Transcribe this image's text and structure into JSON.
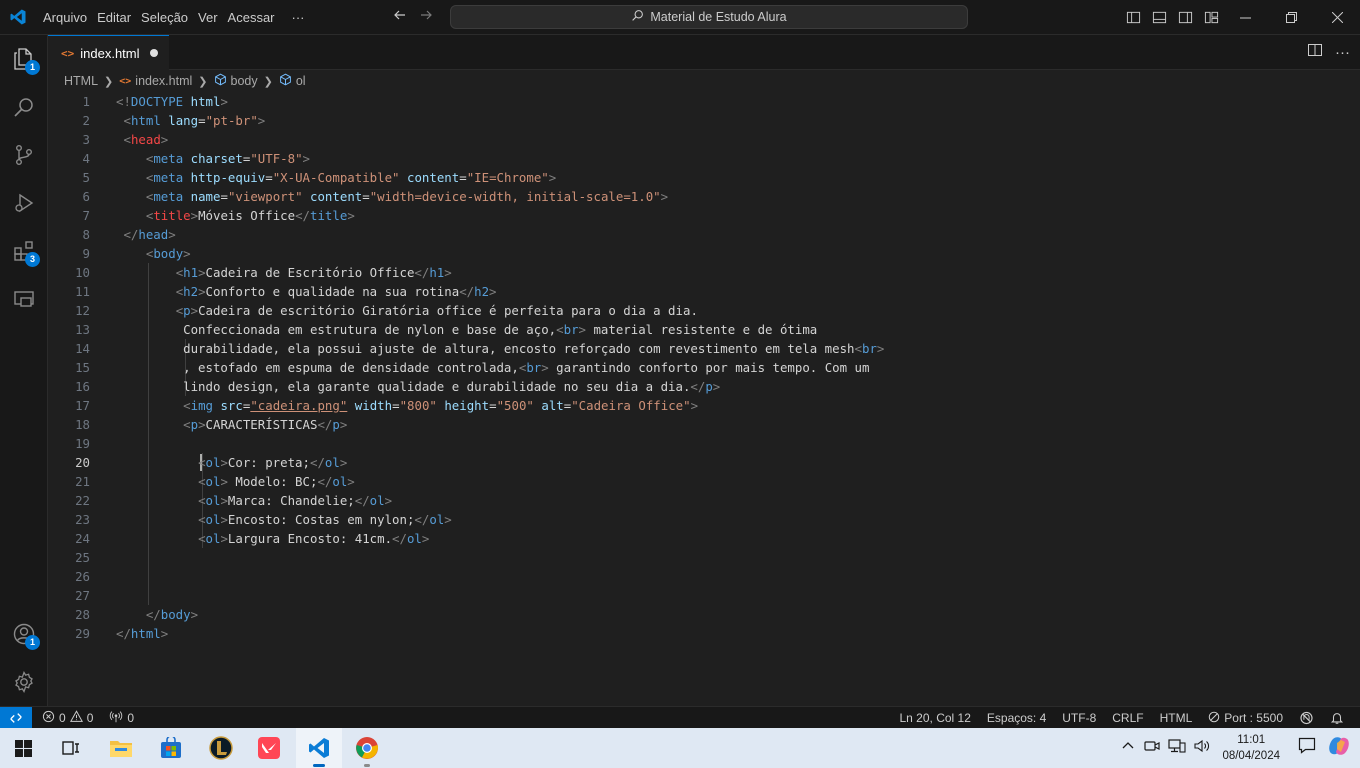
{
  "titlebar": {
    "menu": [
      "Arquivo",
      "Editar",
      "Seleção",
      "Ver",
      "Acessar",
      "···"
    ],
    "search_text": "Material de Estudo Alura"
  },
  "activity": {
    "explorer_badge": "1",
    "extensions_badge": "3",
    "accounts_badge": "1"
  },
  "tab": {
    "label": "index.html"
  },
  "breadcrumb": [
    "HTML",
    "index.html",
    "body",
    "ol"
  ],
  "editor": {
    "active_line": "20",
    "lines": [
      {
        "n": "1",
        "segs": [
          [
            "t",
            "<!"
          ],
          [
            "tg",
            "DOCTYPE"
          ],
          [
            "tx",
            " "
          ],
          [
            "at",
            "html"
          ],
          [
            "t",
            ">"
          ]
        ]
      },
      {
        "n": "2",
        "segs": [
          [
            "tx",
            " "
          ],
          [
            "t",
            "<"
          ],
          [
            "tg",
            "html"
          ],
          [
            "tx",
            " "
          ],
          [
            "at",
            "lang"
          ],
          [
            "tx",
            "="
          ],
          [
            "st",
            "\"pt-br\""
          ],
          [
            "t",
            ">"
          ]
        ]
      },
      {
        "n": "3",
        "segs": [
          [
            "tx",
            " "
          ],
          [
            "t",
            "<"
          ],
          [
            "tr",
            "head"
          ],
          [
            "t",
            ">"
          ]
        ]
      },
      {
        "n": "4",
        "segs": [
          [
            "tx",
            "    "
          ],
          [
            "t",
            "<"
          ],
          [
            "tg",
            "meta"
          ],
          [
            "tx",
            " "
          ],
          [
            "at",
            "charset"
          ],
          [
            "tx",
            "="
          ],
          [
            "st",
            "\"UTF-8\""
          ],
          [
            "t",
            ">"
          ]
        ]
      },
      {
        "n": "5",
        "segs": [
          [
            "tx",
            "    "
          ],
          [
            "t",
            "<"
          ],
          [
            "tg",
            "meta"
          ],
          [
            "tx",
            " "
          ],
          [
            "at",
            "http-equiv"
          ],
          [
            "tx",
            "="
          ],
          [
            "st",
            "\"X-UA-Compatible\""
          ],
          [
            "tx",
            " "
          ],
          [
            "at",
            "content"
          ],
          [
            "tx",
            "="
          ],
          [
            "st",
            "\"IE=Chrome\""
          ],
          [
            "t",
            ">"
          ]
        ]
      },
      {
        "n": "6",
        "segs": [
          [
            "tx",
            "    "
          ],
          [
            "t",
            "<"
          ],
          [
            "tg",
            "meta"
          ],
          [
            "tx",
            " "
          ],
          [
            "at",
            "name"
          ],
          [
            "tx",
            "="
          ],
          [
            "st",
            "\"viewport\""
          ],
          [
            "tx",
            " "
          ],
          [
            "at",
            "content"
          ],
          [
            "tx",
            "="
          ],
          [
            "st",
            "\"width=device-width, initial-scale=1.0\""
          ],
          [
            "t",
            ">"
          ]
        ]
      },
      {
        "n": "7",
        "segs": [
          [
            "tx",
            "    "
          ],
          [
            "t",
            "<"
          ],
          [
            "tr",
            "title"
          ],
          [
            "t",
            ">"
          ],
          [
            "tx",
            "Móveis Office"
          ],
          [
            "t",
            "</"
          ],
          [
            "tg",
            "title"
          ],
          [
            "t",
            ">"
          ]
        ]
      },
      {
        "n": "8",
        "segs": [
          [
            "tx",
            " "
          ],
          [
            "t",
            "</"
          ],
          [
            "tg",
            "head"
          ],
          [
            "t",
            ">"
          ]
        ]
      },
      {
        "n": "9",
        "segs": [
          [
            "tx",
            "    "
          ],
          [
            "t",
            "<"
          ],
          [
            "tg",
            "body"
          ],
          [
            "t",
            ">"
          ]
        ]
      },
      {
        "n": "10",
        "segs": [
          [
            "tx",
            "        "
          ],
          [
            "t",
            "<"
          ],
          [
            "tg",
            "h1"
          ],
          [
            "t",
            ">"
          ],
          [
            "tx",
            "Cadeira de Escritório Office"
          ],
          [
            "t",
            "</"
          ],
          [
            "tg",
            "h1"
          ],
          [
            "t",
            ">"
          ]
        ]
      },
      {
        "n": "11",
        "segs": [
          [
            "tx",
            "        "
          ],
          [
            "t",
            "<"
          ],
          [
            "tg",
            "h2"
          ],
          [
            "t",
            ">"
          ],
          [
            "tx",
            "Conforto e qualidade na sua rotina"
          ],
          [
            "t",
            "</"
          ],
          [
            "tg",
            "h2"
          ],
          [
            "t",
            ">"
          ]
        ]
      },
      {
        "n": "12",
        "segs": [
          [
            "tx",
            "        "
          ],
          [
            "t",
            "<"
          ],
          [
            "tg",
            "p"
          ],
          [
            "t",
            ">"
          ],
          [
            "tx",
            "Cadeira de escritório Giratória office é perfeita para o dia a dia."
          ]
        ]
      },
      {
        "n": "13",
        "segs": [
          [
            "tx",
            "         Confeccionada em estrutura de nylon e base de aço,"
          ],
          [
            "t",
            "<"
          ],
          [
            "tg",
            "br"
          ],
          [
            "t",
            ">"
          ],
          [
            "tx",
            " material resistente e de ótima"
          ]
        ]
      },
      {
        "n": "14",
        "segs": [
          [
            "tx",
            "         durabilidade, ela possui ajuste de altura, encosto reforçado com revestimento em tela mesh"
          ],
          [
            "t",
            "<"
          ],
          [
            "tg",
            "br"
          ],
          [
            "t",
            ">"
          ]
        ]
      },
      {
        "n": "15",
        "segs": [
          [
            "tx",
            "         , estofado em espuma de densidade controlada,"
          ],
          [
            "t",
            "<"
          ],
          [
            "tg",
            "br"
          ],
          [
            "t",
            ">"
          ],
          [
            "tx",
            " garantindo conforto por mais tempo. Com um"
          ]
        ]
      },
      {
        "n": "16",
        "segs": [
          [
            "tx",
            "         lindo design, ela garante qualidade e durabilidade no seu dia a dia."
          ],
          [
            "t",
            "</"
          ],
          [
            "tg",
            "p"
          ],
          [
            "t",
            ">"
          ]
        ]
      },
      {
        "n": "17",
        "segs": [
          [
            "tx",
            "         "
          ],
          [
            "t",
            "<"
          ],
          [
            "tg",
            "img"
          ],
          [
            "tx",
            " "
          ],
          [
            "at",
            "src"
          ],
          [
            "tx",
            "="
          ],
          [
            "st",
            "\"cadeira.png\""
          ],
          [
            "tx",
            " "
          ],
          [
            "at",
            "width"
          ],
          [
            "tx",
            "="
          ],
          [
            "st",
            "\"800\""
          ],
          [
            "tx",
            " "
          ],
          [
            "at",
            "height"
          ],
          [
            "tx",
            "="
          ],
          [
            "st",
            "\"500\""
          ],
          [
            "tx",
            " "
          ],
          [
            "at",
            "alt"
          ],
          [
            "tx",
            "="
          ],
          [
            "st",
            "\"Cadeira Office\""
          ],
          [
            "t",
            ">"
          ]
        ]
      },
      {
        "n": "18",
        "segs": [
          [
            "tx",
            "         "
          ],
          [
            "t",
            "<"
          ],
          [
            "tg",
            "p"
          ],
          [
            "t",
            ">"
          ],
          [
            "tx",
            "CARACTERÍSTICAS"
          ],
          [
            "t",
            "</"
          ],
          [
            "tg",
            "p"
          ],
          [
            "t",
            ">"
          ]
        ]
      },
      {
        "n": "19",
        "segs": []
      },
      {
        "n": "20",
        "segs": [
          [
            "tx",
            "           "
          ],
          [
            "t",
            "<"
          ],
          [
            "tg",
            "ol"
          ],
          [
            "t",
            ">"
          ],
          [
            "tx",
            "Cor: preta;"
          ],
          [
            "t",
            "</"
          ],
          [
            "tg",
            "ol"
          ],
          [
            "t",
            ">"
          ]
        ]
      },
      {
        "n": "21",
        "segs": [
          [
            "tx",
            "           "
          ],
          [
            "t",
            "<"
          ],
          [
            "tg",
            "ol"
          ],
          [
            "t",
            ">"
          ],
          [
            "tx",
            " Modelo: BC;"
          ],
          [
            "t",
            "</"
          ],
          [
            "tg",
            "ol"
          ],
          [
            "t",
            ">"
          ]
        ]
      },
      {
        "n": "22",
        "segs": [
          [
            "tx",
            "           "
          ],
          [
            "t",
            "<"
          ],
          [
            "tg",
            "ol"
          ],
          [
            "t",
            ">"
          ],
          [
            "tx",
            "Marca: Chandelie;"
          ],
          [
            "t",
            "</"
          ],
          [
            "tg",
            "ol"
          ],
          [
            "t",
            ">"
          ]
        ]
      },
      {
        "n": "23",
        "segs": [
          [
            "tx",
            "           "
          ],
          [
            "t",
            "<"
          ],
          [
            "tg",
            "ol"
          ],
          [
            "t",
            ">"
          ],
          [
            "tx",
            "Encosto: Costas em nylon;"
          ],
          [
            "t",
            "</"
          ],
          [
            "tg",
            "ol"
          ],
          [
            "t",
            ">"
          ]
        ]
      },
      {
        "n": "24",
        "segs": [
          [
            "tx",
            "           "
          ],
          [
            "t",
            "<"
          ],
          [
            "tg",
            "ol"
          ],
          [
            "t",
            ">"
          ],
          [
            "tx",
            "Largura Encosto: 41cm."
          ],
          [
            "t",
            "</"
          ],
          [
            "tg",
            "ol"
          ],
          [
            "t",
            ">"
          ]
        ]
      },
      {
        "n": "25",
        "segs": []
      },
      {
        "n": "26",
        "segs": []
      },
      {
        "n": "27",
        "segs": []
      },
      {
        "n": "28",
        "segs": [
          [
            "tx",
            "    "
          ],
          [
            "t",
            "</"
          ],
          [
            "tg",
            "body"
          ],
          [
            "t",
            ">"
          ]
        ]
      },
      {
        "n": "29",
        "segs": [
          [
            "t",
            "</"
          ],
          [
            "tg",
            "html"
          ],
          [
            "t",
            ">"
          ]
        ]
      }
    ]
  },
  "statusbar": {
    "errors": "0",
    "warnings": "0",
    "ports": "0",
    "position": "Ln 20, Col 12",
    "spaces": "Espaços: 4",
    "encoding": "UTF-8",
    "eol": "CRLF",
    "language": "HTML",
    "port": "Port : 5500"
  },
  "taskbar": {
    "time": "11:01",
    "date": "08/04/2024"
  },
  "colors": {
    "accent": "#0078d4",
    "tag": "#569cd6",
    "attr": "#9cdcfe",
    "string": "#ce9178"
  }
}
